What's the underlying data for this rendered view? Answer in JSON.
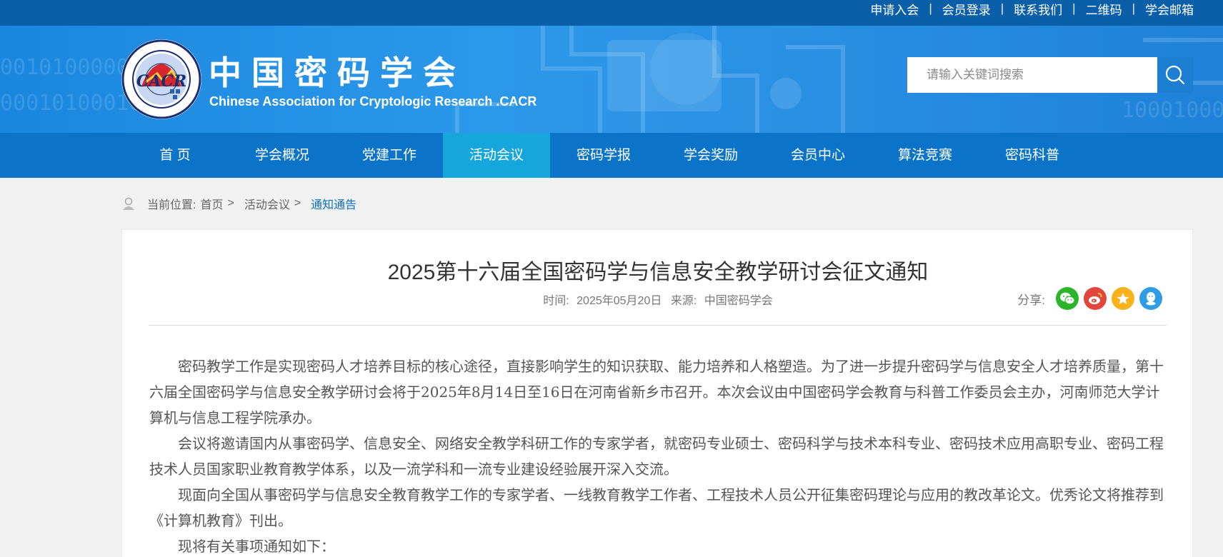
{
  "top_links": [
    "申请入会",
    "会员登录",
    "联系我们",
    "二维码",
    "学会邮箱"
  ],
  "top_separator": "|",
  "logo": {
    "name_cn": "中国密码学会",
    "name_en": "Chinese Association for Cryptologic Research .CACR",
    "seal_text": "CACR"
  },
  "search": {
    "placeholder": "请输入关键词搜索"
  },
  "nav": {
    "items": [
      "首 页",
      "学会概况",
      "党建工作",
      "活动会议",
      "密码学报",
      "学会奖励",
      "会员中心",
      "算法竞赛",
      "密码科普"
    ],
    "active": "活动会议"
  },
  "breadcrumb": {
    "label": "当前位置:",
    "items": [
      "首页",
      "活动会议"
    ],
    "separator": ">",
    "current": "通知通告"
  },
  "article": {
    "title": "2025第十六届全国密码学与信息安全教学研讨会征文通知",
    "time_label": "时间:",
    "time": "2025年05月20日",
    "source_label": "来源:",
    "source": "中国密码学会",
    "share_label": "分享:",
    "share_icons": [
      "wechat-icon",
      "weibo-icon",
      "qzone-icon",
      "qq-icon"
    ],
    "paragraphs": [
      "密码教学工作是实现密码人才培养目标的核心途径，直接影响学生的知识获取、能力培养和人格塑造。为了进一步提升密码学与信息安全人才培养质量，第十六届全国密码学与信息安全教学研讨会将于2025年8月14日至16日在河南省新乡市召开。本次会议由中国密码学会教育与科普工作委员会主办，河南师范大学计算机与信息工程学院承办。",
      "会议将邀请国内从事密码学、信息安全、网络安全教学科研工作的专家学者，就密码专业硕士、密码科学与技术本科专业、密码技术应用高职专业、密码工程技术人员国家职业教育教学体系，以及一流学科和一流专业建设经验展开深入交流。",
      "现面向全国从事密码学与信息安全教育教学工作的专家学者、一线教育教学工作者、工程技术人员公开征集密码理论与应用的教改革论文。优秀论文将推荐到《计算机教育》刊出。",
      "现将有关事项通知如下："
    ]
  },
  "colors": {
    "topbar": "#0a5fa8",
    "nav": "#0b74c9",
    "nav_active": "#16a6dc",
    "wechat": "#2bb52a",
    "weibo": "#e2463b",
    "qzone": "#f7b21c",
    "qq": "#2f9ce6"
  }
}
